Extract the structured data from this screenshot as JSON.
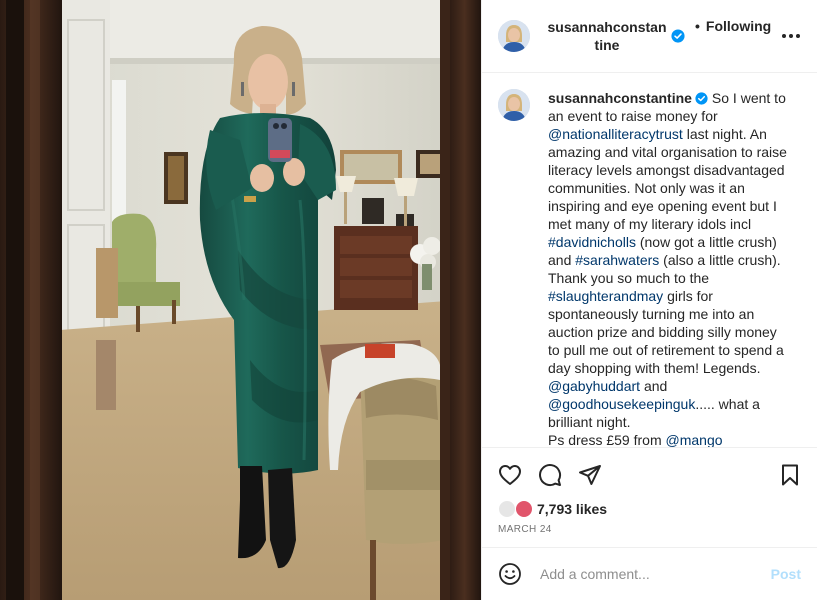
{
  "post": {
    "author": "susannahconstantine",
    "header_author_display": "susannahconstantine",
    "verified": true,
    "follow_state": "Following",
    "separator": "•",
    "caption_segments": [
      {
        "t": "text",
        "v": "So I went to an event to raise money for "
      },
      {
        "t": "tag",
        "v": "@nationalliteracytrust"
      },
      {
        "t": "text",
        "v": " last night. An amazing and vital organisation to raise literacy levels amongst disadvantaged communities. Not only was it an inspiring and eye opening event but I met many of my literary idols incl "
      },
      {
        "t": "tag",
        "v": "#davidnicholls"
      },
      {
        "t": "text",
        "v": " (now got a little crush) and "
      },
      {
        "t": "tag",
        "v": "#sarahwaters"
      },
      {
        "t": "text",
        "v": " (also a little crush). Thank you so much to the "
      },
      {
        "t": "tag",
        "v": "#slaughterandmay"
      },
      {
        "t": "text",
        "v": " girls for spontaneously turning me into an auction prize and bidding silly money to pull me out of retirement to spend a day shopping with them! Legends. "
      },
      {
        "t": "tag",
        "v": "@gabyhuddart"
      },
      {
        "t": "text",
        "v": " and "
      },
      {
        "t": "tag",
        "v": "@goodhousekeepinguk"
      },
      {
        "t": "text",
        "v": "..... what a brilliant night."
      },
      {
        "t": "br"
      },
      {
        "t": "text",
        "v": "Ps dress £59 from "
      },
      {
        "t": "tag",
        "v": "@mango"
      }
    ],
    "likes": "7,793 likes",
    "date": "MARCH 24"
  },
  "actions": {
    "like": "heart-icon",
    "comment": "comment-icon",
    "share": "share-icon",
    "save": "bookmark-icon"
  },
  "comment": {
    "placeholder": "Add a comment...",
    "post_label": "Post"
  },
  "colors": {
    "accent_link": "#00376b",
    "verified": "#0095f6",
    "post_disabled": "#b2dffc",
    "dress": "#1d5f52"
  }
}
